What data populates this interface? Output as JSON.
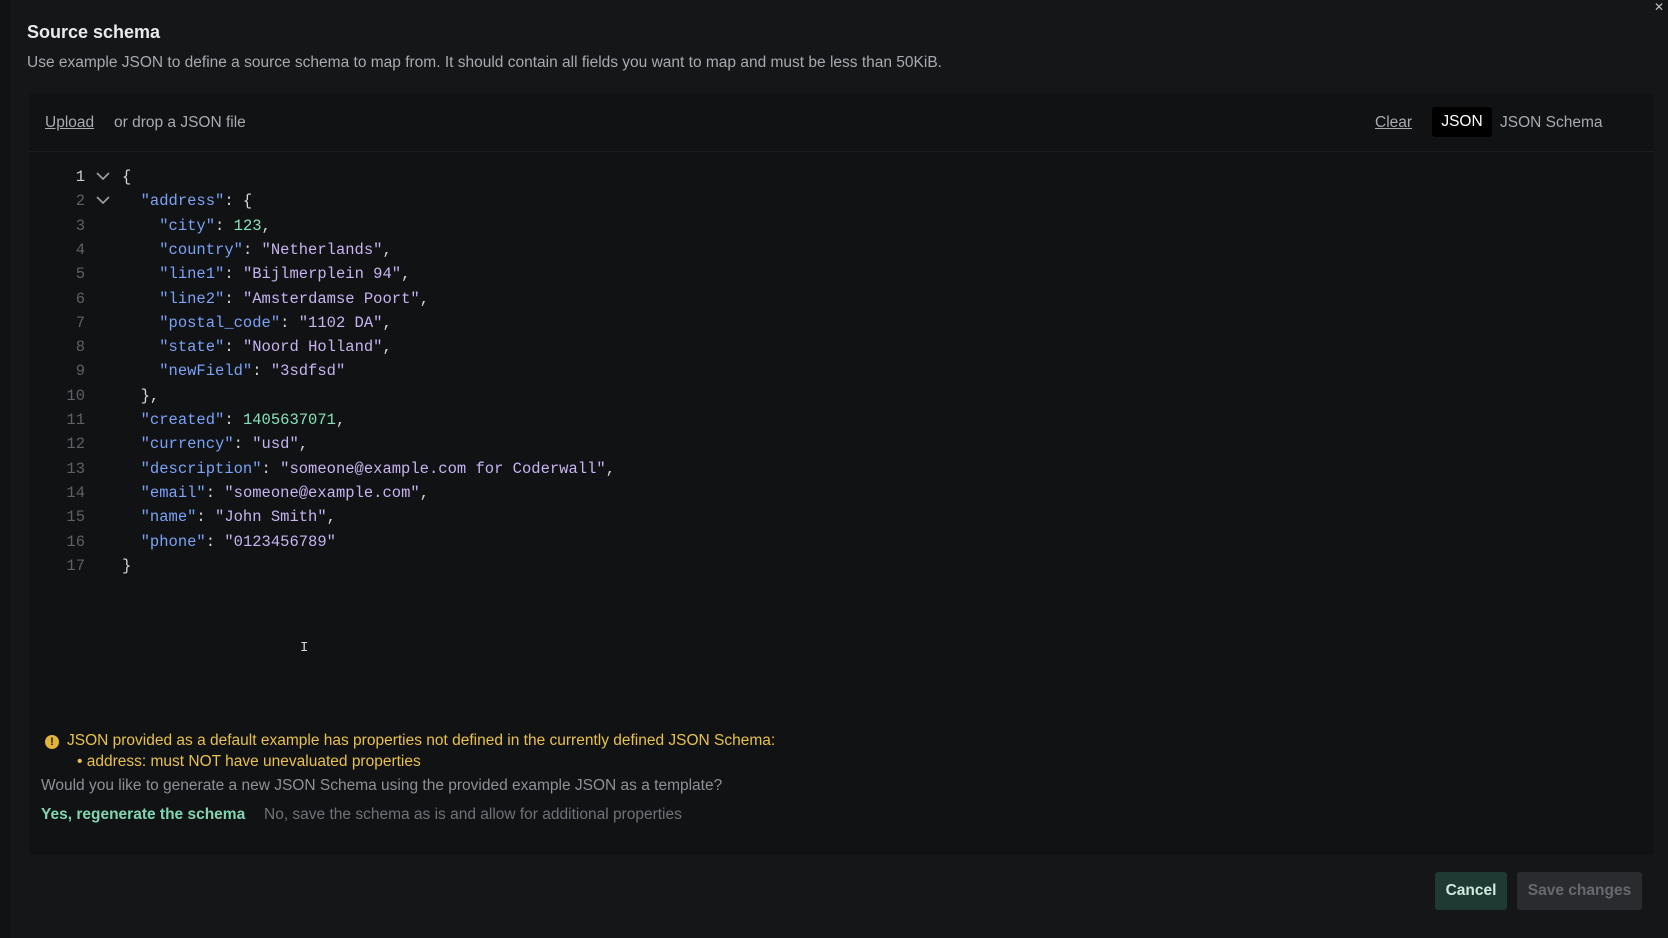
{
  "modal": {
    "title": "Source schema",
    "description": "Use example JSON to define a source schema to map from. It should contain all fields you want to map and must be less than 50KiB."
  },
  "toolbar": {
    "upload_label": "Upload",
    "upload_rest": "or drop a JSON file",
    "clear_label": "Clear",
    "tab_json": "JSON",
    "tab_schema": "JSON Schema"
  },
  "editor": {
    "lines": [
      {
        "n": "1",
        "parts": [
          {
            "t": "{",
            "c": "p"
          }
        ]
      },
      {
        "n": "2",
        "parts": [
          {
            "t": "  "
          },
          {
            "t": "\"address\"",
            "c": "key"
          },
          {
            "t": ": {"
          }
        ]
      },
      {
        "n": "3",
        "parts": [
          {
            "t": "    "
          },
          {
            "t": "\"city\"",
            "c": "key"
          },
          {
            "t": ": "
          },
          {
            "t": "123",
            "c": "num"
          },
          {
            "t": ","
          }
        ]
      },
      {
        "n": "4",
        "parts": [
          {
            "t": "    "
          },
          {
            "t": "\"country\"",
            "c": "key"
          },
          {
            "t": ": "
          },
          {
            "t": "\"Netherlands\"",
            "c": "str"
          },
          {
            "t": ","
          }
        ]
      },
      {
        "n": "5",
        "parts": [
          {
            "t": "    "
          },
          {
            "t": "\"line1\"",
            "c": "key"
          },
          {
            "t": ": "
          },
          {
            "t": "\"Bijlmerplein 94\"",
            "c": "str"
          },
          {
            "t": ","
          }
        ]
      },
      {
        "n": "6",
        "parts": [
          {
            "t": "    "
          },
          {
            "t": "\"line2\"",
            "c": "key"
          },
          {
            "t": ": "
          },
          {
            "t": "\"Amsterdamse Poort\"",
            "c": "str"
          },
          {
            "t": ","
          }
        ]
      },
      {
        "n": "7",
        "parts": [
          {
            "t": "    "
          },
          {
            "t": "\"postal_code\"",
            "c": "key"
          },
          {
            "t": ": "
          },
          {
            "t": "\"1102 DA\"",
            "c": "str"
          },
          {
            "t": ","
          }
        ]
      },
      {
        "n": "8",
        "parts": [
          {
            "t": "    "
          },
          {
            "t": "\"state\"",
            "c": "key"
          },
          {
            "t": ": "
          },
          {
            "t": "\"Noord Holland\"",
            "c": "str"
          },
          {
            "t": ","
          }
        ]
      },
      {
        "n": "9",
        "parts": [
          {
            "t": "    "
          },
          {
            "t": "\"newField\"",
            "c": "key"
          },
          {
            "t": ": "
          },
          {
            "t": "\"3sdfsd\"",
            "c": "str"
          }
        ]
      },
      {
        "n": "10",
        "parts": [
          {
            "t": "  },"
          }
        ]
      },
      {
        "n": "11",
        "parts": [
          {
            "t": "  "
          },
          {
            "t": "\"created\"",
            "c": "key"
          },
          {
            "t": ": "
          },
          {
            "t": "1405637071",
            "c": "num"
          },
          {
            "t": ","
          }
        ]
      },
      {
        "n": "12",
        "parts": [
          {
            "t": "  "
          },
          {
            "t": "\"currency\"",
            "c": "key"
          },
          {
            "t": ": "
          },
          {
            "t": "\"usd\"",
            "c": "str"
          },
          {
            "t": ","
          }
        ]
      },
      {
        "n": "13",
        "parts": [
          {
            "t": "  "
          },
          {
            "t": "\"description\"",
            "c": "key"
          },
          {
            "t": ": "
          },
          {
            "t": "\"someone@example.com for Coderwall\"",
            "c": "str"
          },
          {
            "t": ","
          }
        ]
      },
      {
        "n": "14",
        "parts": [
          {
            "t": "  "
          },
          {
            "t": "\"email\"",
            "c": "key"
          },
          {
            "t": ": "
          },
          {
            "t": "\"someone@example.com\"",
            "c": "str"
          },
          {
            "t": ","
          }
        ]
      },
      {
        "n": "15",
        "parts": [
          {
            "t": "  "
          },
          {
            "t": "\"name\"",
            "c": "key"
          },
          {
            "t": ": "
          },
          {
            "t": "\"John Smith\"",
            "c": "str"
          },
          {
            "t": ","
          }
        ]
      },
      {
        "n": "16",
        "parts": [
          {
            "t": "  "
          },
          {
            "t": "\"phone\"",
            "c": "key"
          },
          {
            "t": ": "
          },
          {
            "t": "\"0123456789\"",
            "c": "str"
          }
        ]
      },
      {
        "n": "17",
        "parts": [
          {
            "t": "}"
          }
        ]
      }
    ]
  },
  "warning": {
    "icon": "warning-icon",
    "message": "JSON provided as a default example has properties not defined in the currently defined JSON Schema:",
    "bullet": "address: must NOT have unevaluated properties",
    "question": "Would you like to generate a new JSON Schema using the provided example JSON as a template?",
    "regenerate_label": "Yes, regenerate the schema",
    "keep_label": "No, save the schema as is and allow for additional properties"
  },
  "footer": {
    "cancel_label": "Cancel",
    "save_label": "Save changes"
  },
  "colors": {
    "key": "#7aa2f7",
    "string": "#c7b3f0",
    "number": "#86e1b7",
    "warning": "#e8c14a",
    "accent": "#7fd6b0"
  }
}
